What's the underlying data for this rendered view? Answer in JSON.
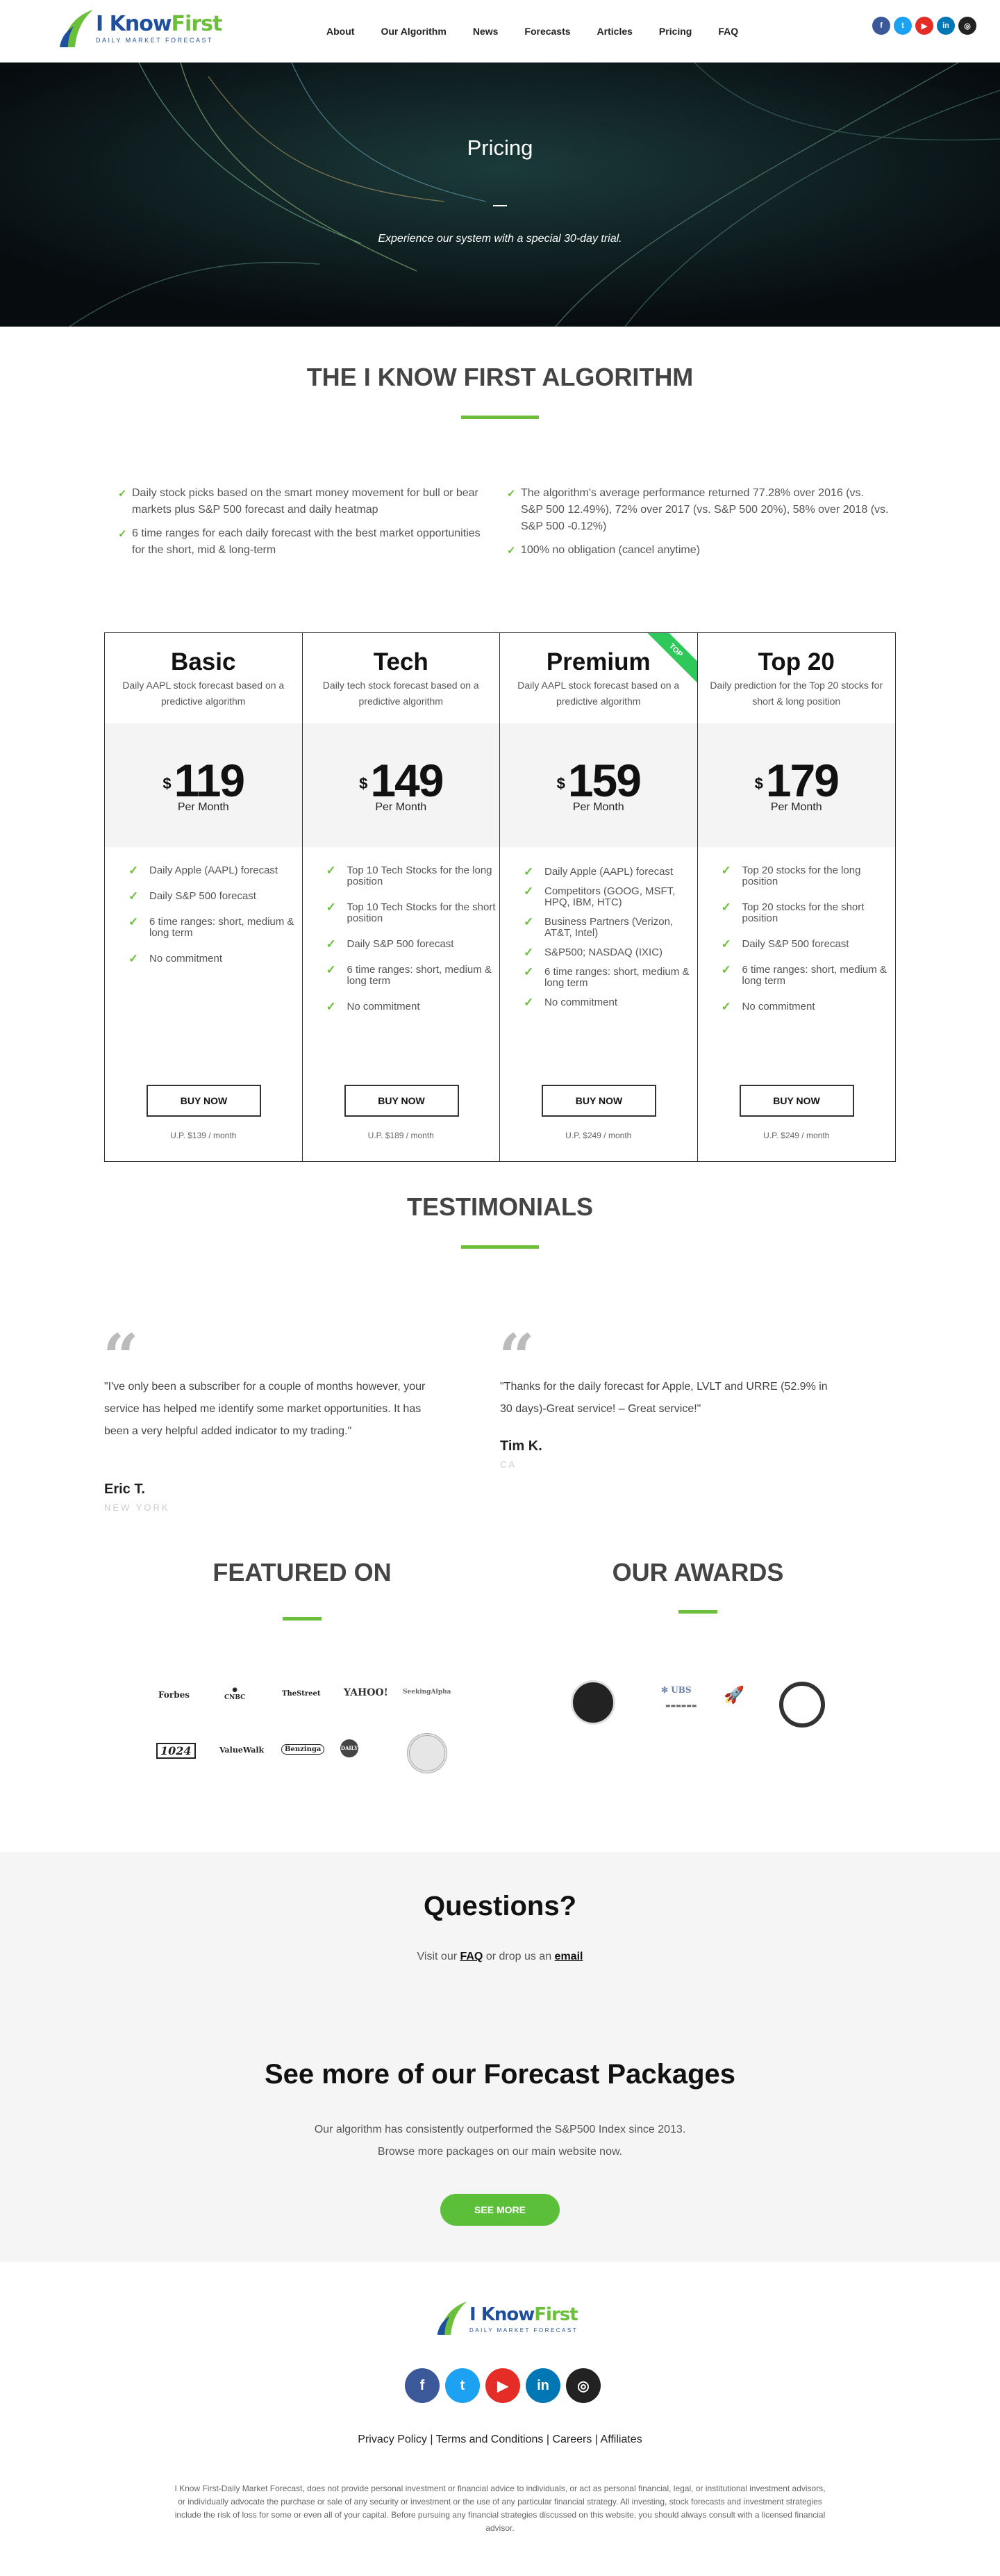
{
  "header": {
    "logo_title_1": "I Know",
    "logo_title_2": "First",
    "logo_sub": "DAILY MARKET FORECAST",
    "nav": [
      "About",
      "Our Algorithm",
      "News",
      "Forecasts",
      "Articles",
      "Pricing",
      "FAQ"
    ],
    "social": [
      "f",
      "t",
      "yt",
      "in",
      "ig"
    ]
  },
  "hero": {
    "title": "Pricing",
    "subtitle": "Experience our system with a special 30-day trial."
  },
  "algorithm": {
    "title": "THE I KNOW FIRST ALGORITHM",
    "left": [
      "Daily stock picks based on the smart money movement for bull or bear markets plus S&P 500 forecast and daily heatmap",
      "6 time ranges for each daily forecast with the best market opportunities for the short, mid & long-term"
    ],
    "right": [
      "The algorithm's average performance returned 77.28% over 2016 (vs. S&P 500 12.49%), 72% over 2017 (vs. S&P 500 20%), 58% over 2018 (vs. S&P 500 -0.12%)",
      "100% no obligation (cancel anytime)"
    ]
  },
  "plans": [
    {
      "name": "Basic",
      "desc": "Daily AAPL stock forecast based on a predictive algorithm",
      "currency": "$",
      "price": "119",
      "per": "Per Month",
      "features": [
        "Daily Apple (AAPL) forecast",
        "Daily S&P 500 forecast",
        "6 time ranges: short, medium & long term",
        "No commitment"
      ],
      "buy": "BUY NOW",
      "up": "U.P. $139 / month"
    },
    {
      "name": "Tech",
      "desc": "Daily tech stock forecast based on a predictive algorithm",
      "currency": "$",
      "price": "149",
      "per": "Per Month",
      "features": [
        "Top 10 Tech Stocks for the long position",
        "Top 10 Tech Stocks for the short position",
        "Daily S&P 500 forecast",
        "6 time ranges: short, medium & long term",
        "No commitment"
      ],
      "buy": "BUY NOW",
      "up": "U.P. $189 / month"
    },
    {
      "name": "Premium",
      "desc": "Daily AAPL stock forecast based on a predictive algorithm",
      "currency": "$",
      "price": "159",
      "per": "Per Month",
      "ribbon": "TOP",
      "features": [
        "Daily Apple (AAPL) forecast",
        "Competitors (GOOG, MSFT, HPQ, IBM, HTC)",
        "Business Partners (Verizon, AT&T, Intel)",
        "S&P500; NASDAQ (IXIC)",
        "6 time ranges: short, medium & long term",
        "No commitment"
      ],
      "buy": "BUY NOW",
      "up": "U.P. $249 / month"
    },
    {
      "name": "Top 20",
      "desc": "Daily prediction for the Top 20 stocks for short & long position",
      "currency": "$",
      "price": "179",
      "per": "Per Month",
      "features": [
        "Top 20 stocks for the long position",
        "Top 20 stocks for the short position",
        "Daily S&P 500 forecast",
        "6 time ranges: short, medium & long term",
        "No commitment"
      ],
      "buy": "BUY NOW",
      "up": "U.P. $249 / month"
    }
  ],
  "testimonials": {
    "title": "TESTIMONIALS",
    "items": [
      {
        "quote": "\"I've only been a subscriber for a couple of months however, your service has helped me identify some market opportunities. It has been a very helpful added indicator to my trading.\"",
        "name": "Eric T.",
        "location": "NEW YORK"
      },
      {
        "quote": "\"Thanks for the daily forecast for Apple, LVLT and URRE (52.9% in 30 days)-Great service! – Great service!\"",
        "name": "Tim K.",
        "location": "CA"
      }
    ]
  },
  "featured": {
    "title": "FEATURED ON",
    "logos": [
      "Forbes",
      "CNBC",
      "TheStreet",
      "YAHOO!",
      "SeekingAlpha",
      "1024",
      "ValueWalk",
      "Benzinga",
      "DAILY",
      "Seal"
    ]
  },
  "awards": {
    "title": "OUR AWARDS"
  },
  "questions": {
    "title": "Questions?",
    "text_pre": "Visit our ",
    "faq": "FAQ",
    "text_mid": " or drop us an ",
    "email": "email"
  },
  "more": {
    "title": "See more of our Forecast Packages",
    "line1": "Our algorithm has consistently outperformed the S&P500 Index since 2013.",
    "line2": "Browse more packages on our main website now.",
    "button": "SEE MORE"
  },
  "footer": {
    "links": [
      "Privacy Policy",
      "Terms and Conditions",
      "Careers",
      "Affiliates"
    ],
    "disclaimer": "I Know First-Daily Market Forecast, does not provide personal investment or financial advice to individuals, or act as personal financial, legal, or institutional investment advisors, or individually advocate the purchase or sale of any security or investment or the use of any particular financial strategy. All investing, stock forecasts and investment strategies include the risk of loss for some or even all of your capital. Before pursuing any financial strategies discussed on this website, you should always consult with a licensed financial advisor."
  },
  "colors": {
    "accent": "#6bbf3a",
    "brand_blue": "#1e4f9e",
    "facebook": "#3b5998",
    "twitter": "#1da1f2",
    "youtube": "#e52d27",
    "linkedin": "#0077b5",
    "instagram": "#222222"
  }
}
